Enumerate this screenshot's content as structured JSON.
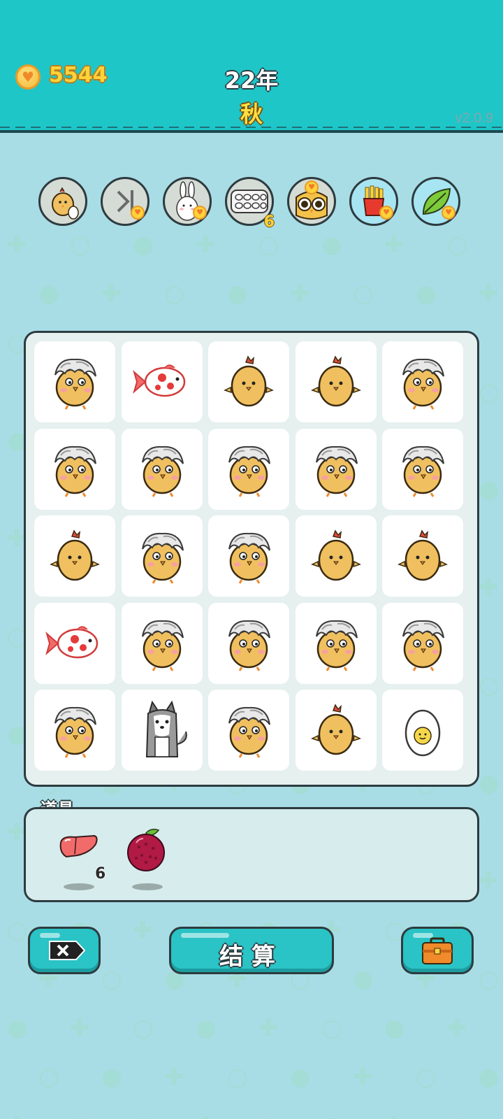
{
  "header": {
    "coins": "5544",
    "year": "22年",
    "season": "秋",
    "version": "v2.0.9"
  },
  "perks": [
    {
      "icon": "chick-egg-icon",
      "count": ""
    },
    {
      "icon": "skip-forward-icon",
      "count": ""
    },
    {
      "icon": "rabbit-icon",
      "count": ""
    },
    {
      "icon": "egg-carton-icon",
      "count": "6"
    },
    {
      "icon": "owl-icon",
      "count": ""
    },
    {
      "icon": "fries-icon",
      "count": ""
    },
    {
      "icon": "leaf-icon",
      "count": ""
    }
  ],
  "board": [
    [
      "rooster",
      "fish",
      "chick",
      "chick",
      "rooster"
    ],
    [
      "rooster",
      "rooster",
      "rooster",
      "rooster",
      "rooster"
    ],
    [
      "chick",
      "rooster",
      "rooster",
      "chick",
      "chick"
    ],
    [
      "fish",
      "rooster",
      "rooster",
      "rooster",
      "rooster"
    ],
    [
      "rooster",
      "husky",
      "rooster",
      "chick",
      "egg"
    ]
  ],
  "items": {
    "label": "道具",
    "list": [
      {
        "icon": "liver-icon",
        "count": "6"
      },
      {
        "icon": "bayberry-icon",
        "count": ""
      }
    ]
  },
  "buttons": {
    "settle_label": "结算",
    "close_icon": "close-icon",
    "bag_icon": "briefcase-icon"
  },
  "colors": {
    "header_bg": "#1ec6c8",
    "page_bg": "#a9dde6",
    "coin_text": "#ffd23a",
    "button_bg": "#2ac3c6"
  }
}
